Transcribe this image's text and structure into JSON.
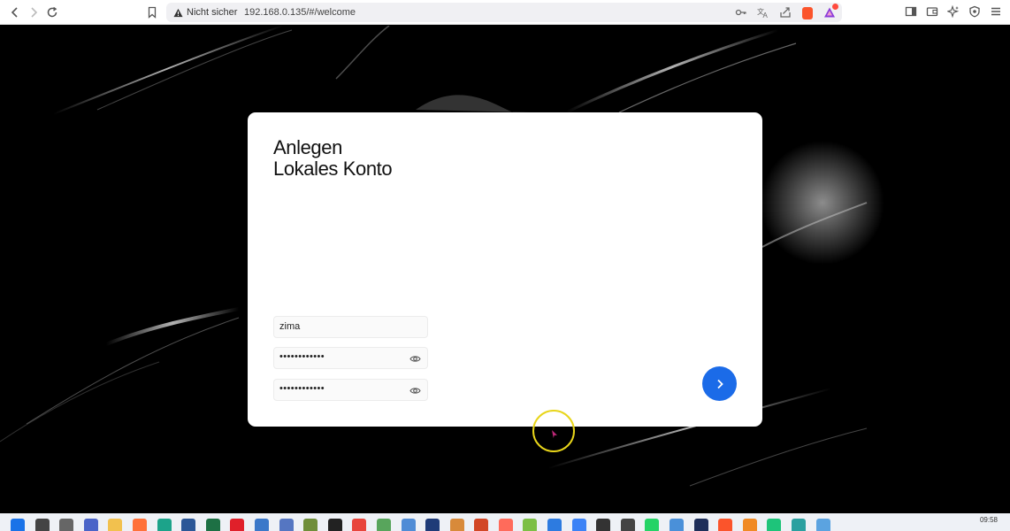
{
  "browser": {
    "security_label": "Nicht sicher",
    "url": "192.168.0.135/#/welcome"
  },
  "card": {
    "title_line1": "Anlegen",
    "title_line2": "Lokales Konto",
    "username_value": "zima",
    "password_value": "••••••••••••",
    "confirm_password_value": "••••••••••••"
  },
  "taskbar": {
    "clock_time": "09:58",
    "icons": [
      {
        "name": "windows-start-icon",
        "color": "#1a73e8"
      },
      {
        "name": "search-icon",
        "color": "#444444"
      },
      {
        "name": "task-view-icon",
        "color": "#666666"
      },
      {
        "name": "teams-icon",
        "color": "#4a64c8"
      },
      {
        "name": "file-explorer-icon",
        "color": "#f2c14e"
      },
      {
        "name": "firefox-icon",
        "color": "#ff7139"
      },
      {
        "name": "edge-icon",
        "color": "#1ca38a"
      },
      {
        "name": "word-icon",
        "color": "#2b5797"
      },
      {
        "name": "excel-icon",
        "color": "#1d7044"
      },
      {
        "name": "opera-icon",
        "color": "#e0202a"
      },
      {
        "name": "app-icon-1",
        "color": "#3a78c9"
      },
      {
        "name": "active-app-icon",
        "color": "#5576c2"
      },
      {
        "name": "minecraft-icon",
        "color": "#6f8e3a"
      },
      {
        "name": "notion-icon",
        "color": "#222222"
      },
      {
        "name": "chrome-icon",
        "color": "#e8453c"
      },
      {
        "name": "notepad-icon",
        "color": "#58a55c"
      },
      {
        "name": "mail-icon",
        "color": "#4f8cd6"
      },
      {
        "name": "app-icon-2",
        "color": "#1f3b78"
      },
      {
        "name": "photos-icon",
        "color": "#d88a3a"
      },
      {
        "name": "powerpoint-icon",
        "color": "#d24726"
      },
      {
        "name": "snipping-icon",
        "color": "#ff6b5b"
      },
      {
        "name": "app-icon-3",
        "color": "#7cbf45"
      },
      {
        "name": "app-icon-4",
        "color": "#2d7be0"
      },
      {
        "name": "app-icon-5",
        "color": "#3b82f6"
      },
      {
        "name": "chatgpt-icon",
        "color": "#333333"
      },
      {
        "name": "app-icon-6",
        "color": "#444444"
      },
      {
        "name": "whatsapp-icon",
        "color": "#25d366"
      },
      {
        "name": "app-icon-7",
        "color": "#4a90d9"
      },
      {
        "name": "app-icon-8",
        "color": "#1e2f5a"
      },
      {
        "name": "brave-icon",
        "color": "#fb542b"
      },
      {
        "name": "app-icon-9",
        "color": "#f08a24"
      },
      {
        "name": "app-icon-10",
        "color": "#1ec47a"
      },
      {
        "name": "app-icon-11",
        "color": "#2aa0a0"
      },
      {
        "name": "app-icon-12",
        "color": "#5ba3e0"
      }
    ]
  }
}
